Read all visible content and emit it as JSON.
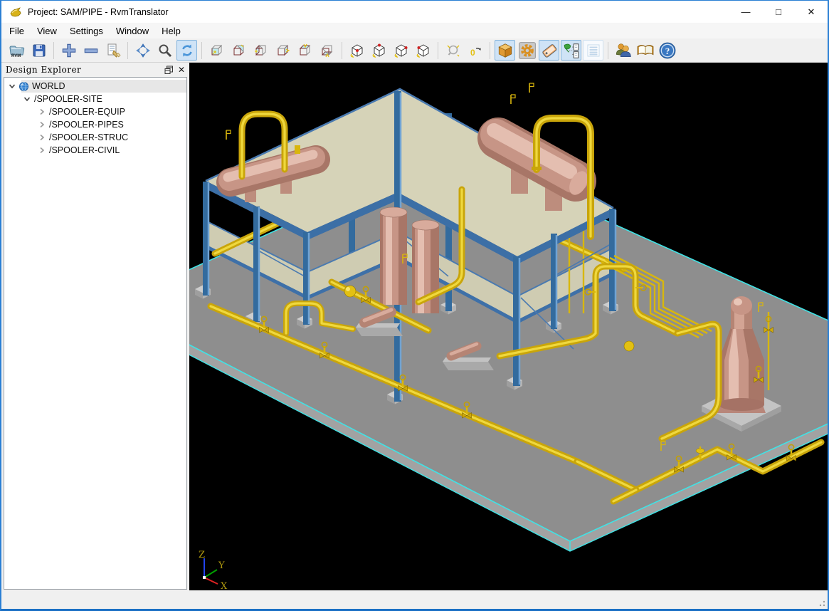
{
  "window": {
    "title": "Project: SAM/PIPE - RvmTranslator",
    "controls": {
      "minimize": "—",
      "maximize": "□",
      "close": "✕"
    }
  },
  "menu": {
    "items": [
      "File",
      "View",
      "Settings",
      "Window",
      "Help"
    ]
  },
  "toolbar": {
    "icons": [
      {
        "name": "open-rvm-file",
        "state": "normal"
      },
      {
        "name": "save",
        "state": "normal"
      },
      {
        "name": "zoom-in-plus",
        "state": "normal"
      },
      {
        "name": "zoom-out-minus",
        "state": "normal"
      },
      {
        "name": "clear-document",
        "state": "normal"
      },
      {
        "name": "fit-view-compass",
        "state": "normal"
      },
      {
        "name": "zoom-magnifier",
        "state": "normal"
      },
      {
        "name": "refresh-view",
        "state": "active"
      },
      {
        "name": "view-cube-front",
        "state": "normal"
      },
      {
        "name": "view-cube-back",
        "state": "normal"
      },
      {
        "name": "view-cube-left",
        "state": "normal"
      },
      {
        "name": "view-cube-right",
        "state": "normal"
      },
      {
        "name": "view-cube-top",
        "state": "normal"
      },
      {
        "name": "view-cube-bottom",
        "state": "normal"
      },
      {
        "name": "iso-view-1",
        "state": "normal"
      },
      {
        "name": "iso-view-2",
        "state": "normal"
      },
      {
        "name": "iso-view-3",
        "state": "normal"
      },
      {
        "name": "iso-view-4",
        "state": "normal"
      },
      {
        "name": "zoom-window",
        "state": "disabled"
      },
      {
        "name": "rotate-reset-zero",
        "state": "normal"
      },
      {
        "name": "shaded-cube-view",
        "state": "active"
      },
      {
        "name": "render-settings-gear",
        "state": "normal"
      },
      {
        "name": "annotation-tag",
        "state": "active"
      },
      {
        "name": "model-tree-structure",
        "state": "active"
      },
      {
        "name": "list-view",
        "state": "disabled"
      },
      {
        "name": "users",
        "state": "normal"
      },
      {
        "name": "manual-book",
        "state": "normal"
      },
      {
        "name": "help",
        "state": "normal"
      }
    ]
  },
  "dock": {
    "title": "Design Explorer"
  },
  "tree": {
    "selected": "WORLD",
    "items": [
      {
        "label": "WORLD",
        "level": 0,
        "expanded": true,
        "icon": "globe",
        "selected": true
      },
      {
        "label": "/SPOOLER-SITE",
        "level": 1,
        "expanded": true,
        "selected": false
      },
      {
        "label": "/SPOOLER-EQUIP",
        "level": 2,
        "expanded": false,
        "selected": false
      },
      {
        "label": "/SPOOLER-PIPES",
        "level": 2,
        "expanded": false,
        "selected": false
      },
      {
        "label": "/SPOOLER-STRUC",
        "level": 2,
        "expanded": false,
        "selected": false
      },
      {
        "label": "/SPOOLER-CIVIL",
        "level": 2,
        "expanded": false,
        "selected": false
      }
    ]
  },
  "viewport": {
    "background": "#000000",
    "axis": {
      "x": "X",
      "y": "Y",
      "z": "Z"
    },
    "scene": "isometric piping plant model: gray concrete slab with cyan edges, blue steel structure with beige platform decks, yellow piping with valves, salmon equipment vessels and pumps"
  },
  "colors": {
    "accent_border": "#2a7fd4",
    "toolbar_active_bg": "#cfe3f6",
    "slab": "#8e8e8e",
    "slab_edge": "#3fe3e6",
    "steel": "#336b9e",
    "deck": "#d6d3b8",
    "pipe": "#d9b60c",
    "vessel": "#c09080"
  }
}
